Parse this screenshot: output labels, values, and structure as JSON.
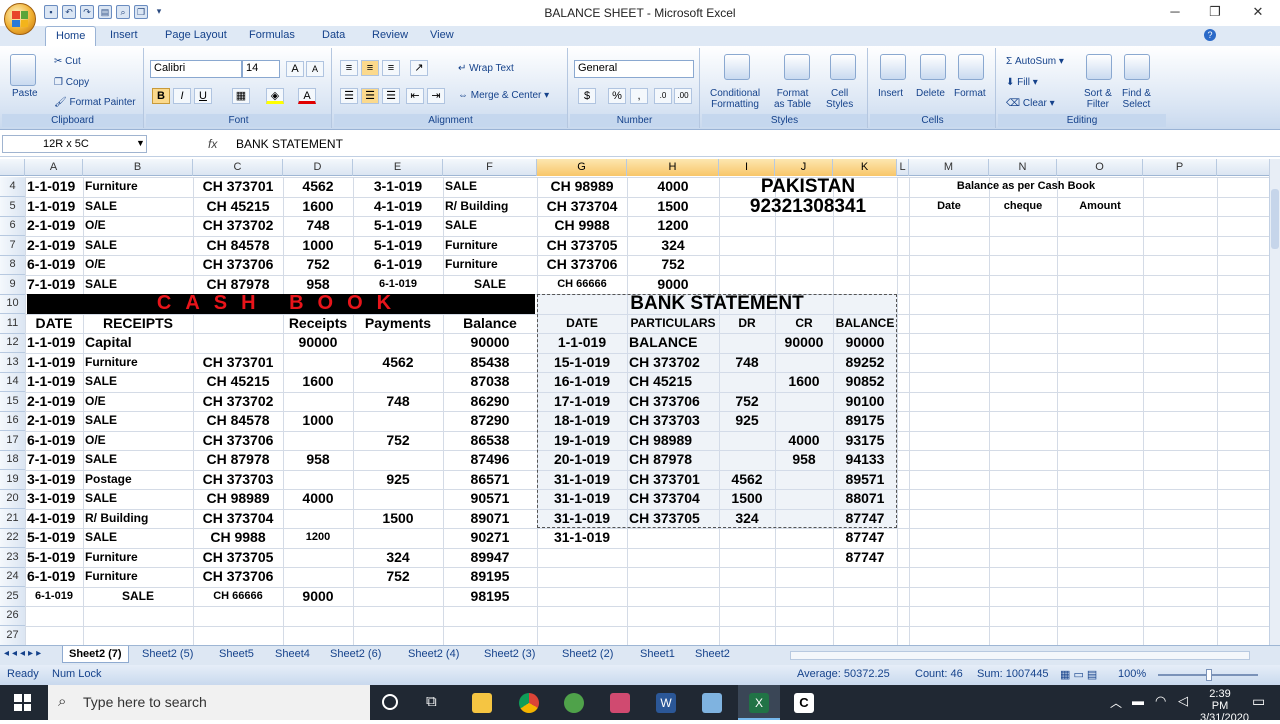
{
  "window": {
    "title": "BALANCE SHEET - Microsoft Excel"
  },
  "ribbon_tabs": [
    "Home",
    "Insert",
    "Page Layout",
    "Formulas",
    "Data",
    "Review",
    "View"
  ],
  "ribbon": {
    "clipboard": {
      "paste": "Paste",
      "cut": "Cut",
      "copy": "Copy",
      "format_painter": "Format Painter",
      "group": "Clipboard"
    },
    "font": {
      "name": "Calibri",
      "size": "14",
      "group": "Font",
      "bold": "B",
      "italic": "I",
      "underline": "U"
    },
    "alignment": {
      "wrap": "Wrap Text",
      "merge": "Merge & Center",
      "group": "Alignment"
    },
    "number": {
      "format": "General",
      "currency": "$",
      "percent": "%",
      "comma": ",",
      "group": "Number"
    },
    "styles": {
      "conditional": "Conditional",
      "conditional2": "Formatting",
      "format_table": "Format",
      "format_table2": "as Table",
      "cell_styles": "Cell",
      "cell_styles2": "Styles",
      "group": "Styles"
    },
    "cells": {
      "insert": "Insert",
      "delete": "Delete",
      "format": "Format",
      "group": "Cells"
    },
    "editing": {
      "autosum": "AutoSum",
      "fill": "Fill",
      "clear": "Clear",
      "sort": "Sort &",
      "sort2": "Filter",
      "find": "Find &",
      "find2": "Select",
      "group": "Editing"
    }
  },
  "formula_bar": {
    "name_box": "12R x 5C",
    "fx": "fx",
    "content": "BANK STATEMENT"
  },
  "columns": [
    "A",
    "B",
    "C",
    "D",
    "E",
    "F",
    "G",
    "H",
    "I",
    "J",
    "K",
    "L",
    "M",
    "N",
    "O",
    "P"
  ],
  "rows": [
    "4",
    "5",
    "6",
    "7",
    "8",
    "9",
    "10",
    "11",
    "12",
    "13",
    "14",
    "15",
    "16",
    "17",
    "18",
    "19",
    "20",
    "21",
    "22",
    "23",
    "24",
    "25",
    "26",
    "27"
  ],
  "top_block": [
    [
      "1-1-019",
      "Furniture",
      "CH 373701",
      "4562",
      "3-1-019",
      "SALE",
      "CH 98989",
      "4000"
    ],
    [
      "1-1-019",
      "SALE",
      "CH 45215",
      "1600",
      "4-1-019",
      "R/ Building",
      "CH 373704",
      "1500"
    ],
    [
      "2-1-019",
      "O/E",
      "CH 373702",
      "748",
      "5-1-019",
      "SALE",
      "CH 9988",
      "1200"
    ],
    [
      "2-1-019",
      "SALE",
      "CH 84578",
      "1000",
      "5-1-019",
      "Furniture",
      "CH 373705",
      "324"
    ],
    [
      "6-1-019",
      "O/E",
      "CH 373706",
      "752",
      "6-1-019",
      "Furniture",
      "CH 373706",
      "752"
    ],
    [
      "7-1-019",
      "SALE",
      "CH 87978",
      "958",
      "6-1-019",
      "SALE",
      "CH 66666",
      "9000"
    ]
  ],
  "pakistan": {
    "line1": "PAKISTAN",
    "line2": "92321308341"
  },
  "side_header": {
    "title": "Balance as per Cash Book",
    "date": "Date",
    "cheque": "cheque",
    "amount": "Amount"
  },
  "cash_book": {
    "title": "CASH BOOK",
    "headers": [
      "DATE",
      "RECEIPTS",
      "",
      "Receipts",
      "Payments",
      "Balance"
    ],
    "rows": [
      [
        "1-1-019",
        "Capital",
        "",
        "90000",
        "",
        "90000"
      ],
      [
        "1-1-019",
        "Furniture",
        "CH 373701",
        "",
        "4562",
        "85438"
      ],
      [
        "1-1-019",
        "SALE",
        "CH 45215",
        "1600",
        "",
        "87038"
      ],
      [
        "2-1-019",
        "O/E",
        "CH 373702",
        "",
        "748",
        "86290"
      ],
      [
        "2-1-019",
        "SALE",
        "CH 84578",
        "1000",
        "",
        "87290"
      ],
      [
        "6-1-019",
        "O/E",
        "CH 373706",
        "",
        "752",
        "86538"
      ],
      [
        "7-1-019",
        "SALE",
        "CH 87978",
        "958",
        "",
        "87496"
      ],
      [
        "3-1-019",
        "Postage",
        "CH 373703",
        "",
        "925",
        "86571"
      ],
      [
        "3-1-019",
        "SALE",
        "CH 98989",
        "4000",
        "",
        "90571"
      ],
      [
        "4-1-019",
        "R/ Building",
        "CH 373704",
        "",
        "1500",
        "89071"
      ],
      [
        "5-1-019",
        "SALE",
        "CH 9988",
        "1200",
        "",
        "90271"
      ],
      [
        "5-1-019",
        "Furniture",
        "CH 373705",
        "",
        "324",
        "89947"
      ],
      [
        "6-1-019",
        "Furniture",
        "CH 373706",
        "",
        "752",
        "89195"
      ],
      [
        "6-1-019",
        "SALE",
        "CH 66666",
        "9000",
        "",
        "98195"
      ]
    ]
  },
  "bank_statement": {
    "title": "BANK STATEMENT",
    "headers": [
      "DATE",
      "PARTICULARS",
      "DR",
      "CR",
      "BALANCE"
    ],
    "rows": [
      [
        "1-1-019",
        "BALANCE",
        "",
        "90000",
        "90000"
      ],
      [
        "15-1-019",
        "CH 373702",
        "748",
        "",
        "89252"
      ],
      [
        "16-1-019",
        "CH 45215",
        "",
        "1600",
        "90852"
      ],
      [
        "17-1-019",
        "CH 373706",
        "752",
        "",
        "90100"
      ],
      [
        "18-1-019",
        "CH 373703",
        "925",
        "",
        "89175"
      ],
      [
        "19-1-019",
        "CH 98989",
        "",
        "4000",
        "93175"
      ],
      [
        "20-1-019",
        "CH 87978",
        "",
        "958",
        "94133"
      ],
      [
        "31-1-019",
        "CH 373701",
        "4562",
        "",
        "89571"
      ],
      [
        "31-1-019",
        "CH 373704",
        "1500",
        "",
        "88071"
      ],
      [
        "31-1-019",
        "CH 373705",
        "324",
        "",
        "87747"
      ],
      [
        "31-1-019",
        "",
        "",
        "",
        "87747"
      ],
      [
        "",
        "",
        "",
        "",
        "87747"
      ]
    ]
  },
  "sheet_tabs": [
    "Sheet2 (7)",
    "Sheet2 (5)",
    "Sheet5",
    "Sheet4",
    "Sheet2 (6)",
    "Sheet2 (4)",
    "Sheet2 (3)",
    "Sheet2 (2)",
    "Sheet1",
    "Sheet2"
  ],
  "status": {
    "ready": "Ready",
    "numlock": "Num Lock",
    "average": "Average: 50372.25",
    "count": "Count: 46",
    "sum": "Sum: 1007445",
    "zoom": "100%"
  },
  "taskbar": {
    "search": "Type here to search",
    "time": "2:39 PM",
    "date": "3/31/2020"
  }
}
